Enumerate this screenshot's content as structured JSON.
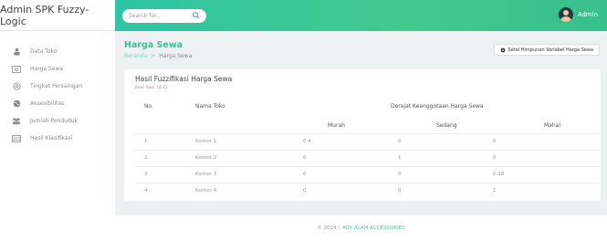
{
  "app": {
    "title": "Admin SPK Fuzzy-Logic"
  },
  "search": {
    "placeholder": "Search for..."
  },
  "user": {
    "name": "Admin"
  },
  "sidebar": {
    "items": [
      {
        "label": "Data Toko",
        "icon": "store-icon"
      },
      {
        "label": "Harga Sewa",
        "icon": "money-icon"
      },
      {
        "label": "Tingkat Persaingan",
        "icon": "target-icon"
      },
      {
        "label": "Aksesibilitas",
        "icon": "globe-icon"
      },
      {
        "label": "Jumlah Penduduk",
        "icon": "users-icon"
      },
      {
        "label": "Hasil Klasifikasi",
        "icon": "table-icon"
      }
    ]
  },
  "page": {
    "title": "Harga Sewa",
    "breadcrumb": {
      "home": "Beranda",
      "sep": ">",
      "current": "Harga Sewa"
    },
    "settings_button": "Setel Himpunan Variabel Harga Sewa"
  },
  "card": {
    "title": "Hasil Fuzzifikasi Harga Sewa",
    "subtitle": "Real Toko",
    "badge": "[4-1]"
  },
  "table": {
    "headers": {
      "no": "No.",
      "name": "Nama Toko",
      "group": "Derajat Keanggotaan Harga Sewa"
    },
    "subheaders": [
      "Murah",
      "Sedang",
      "Mahal"
    ],
    "rows": [
      {
        "no": "1",
        "name": "Konter 1",
        "murah": "0.4",
        "sedang": "0",
        "mahal": "0"
      },
      {
        "no": "2",
        "name": "Konter 2",
        "murah": "0",
        "sedang": "1",
        "mahal": "0"
      },
      {
        "no": "3",
        "name": "Konter 3",
        "murah": "0",
        "sedang": "0",
        "mahal": "0.18"
      },
      {
        "no": "4",
        "name": "Konter 4",
        "murah": "0",
        "sedang": "0",
        "mahal": "1"
      }
    ]
  },
  "footer": {
    "text": "© 2024 |",
    "brand": "ADY ALAM ACCESSORIES"
  },
  "colors": {
    "accent": "#3bbf8f",
    "topbar": "#2ec5a4",
    "badge": "#e56b6b"
  }
}
